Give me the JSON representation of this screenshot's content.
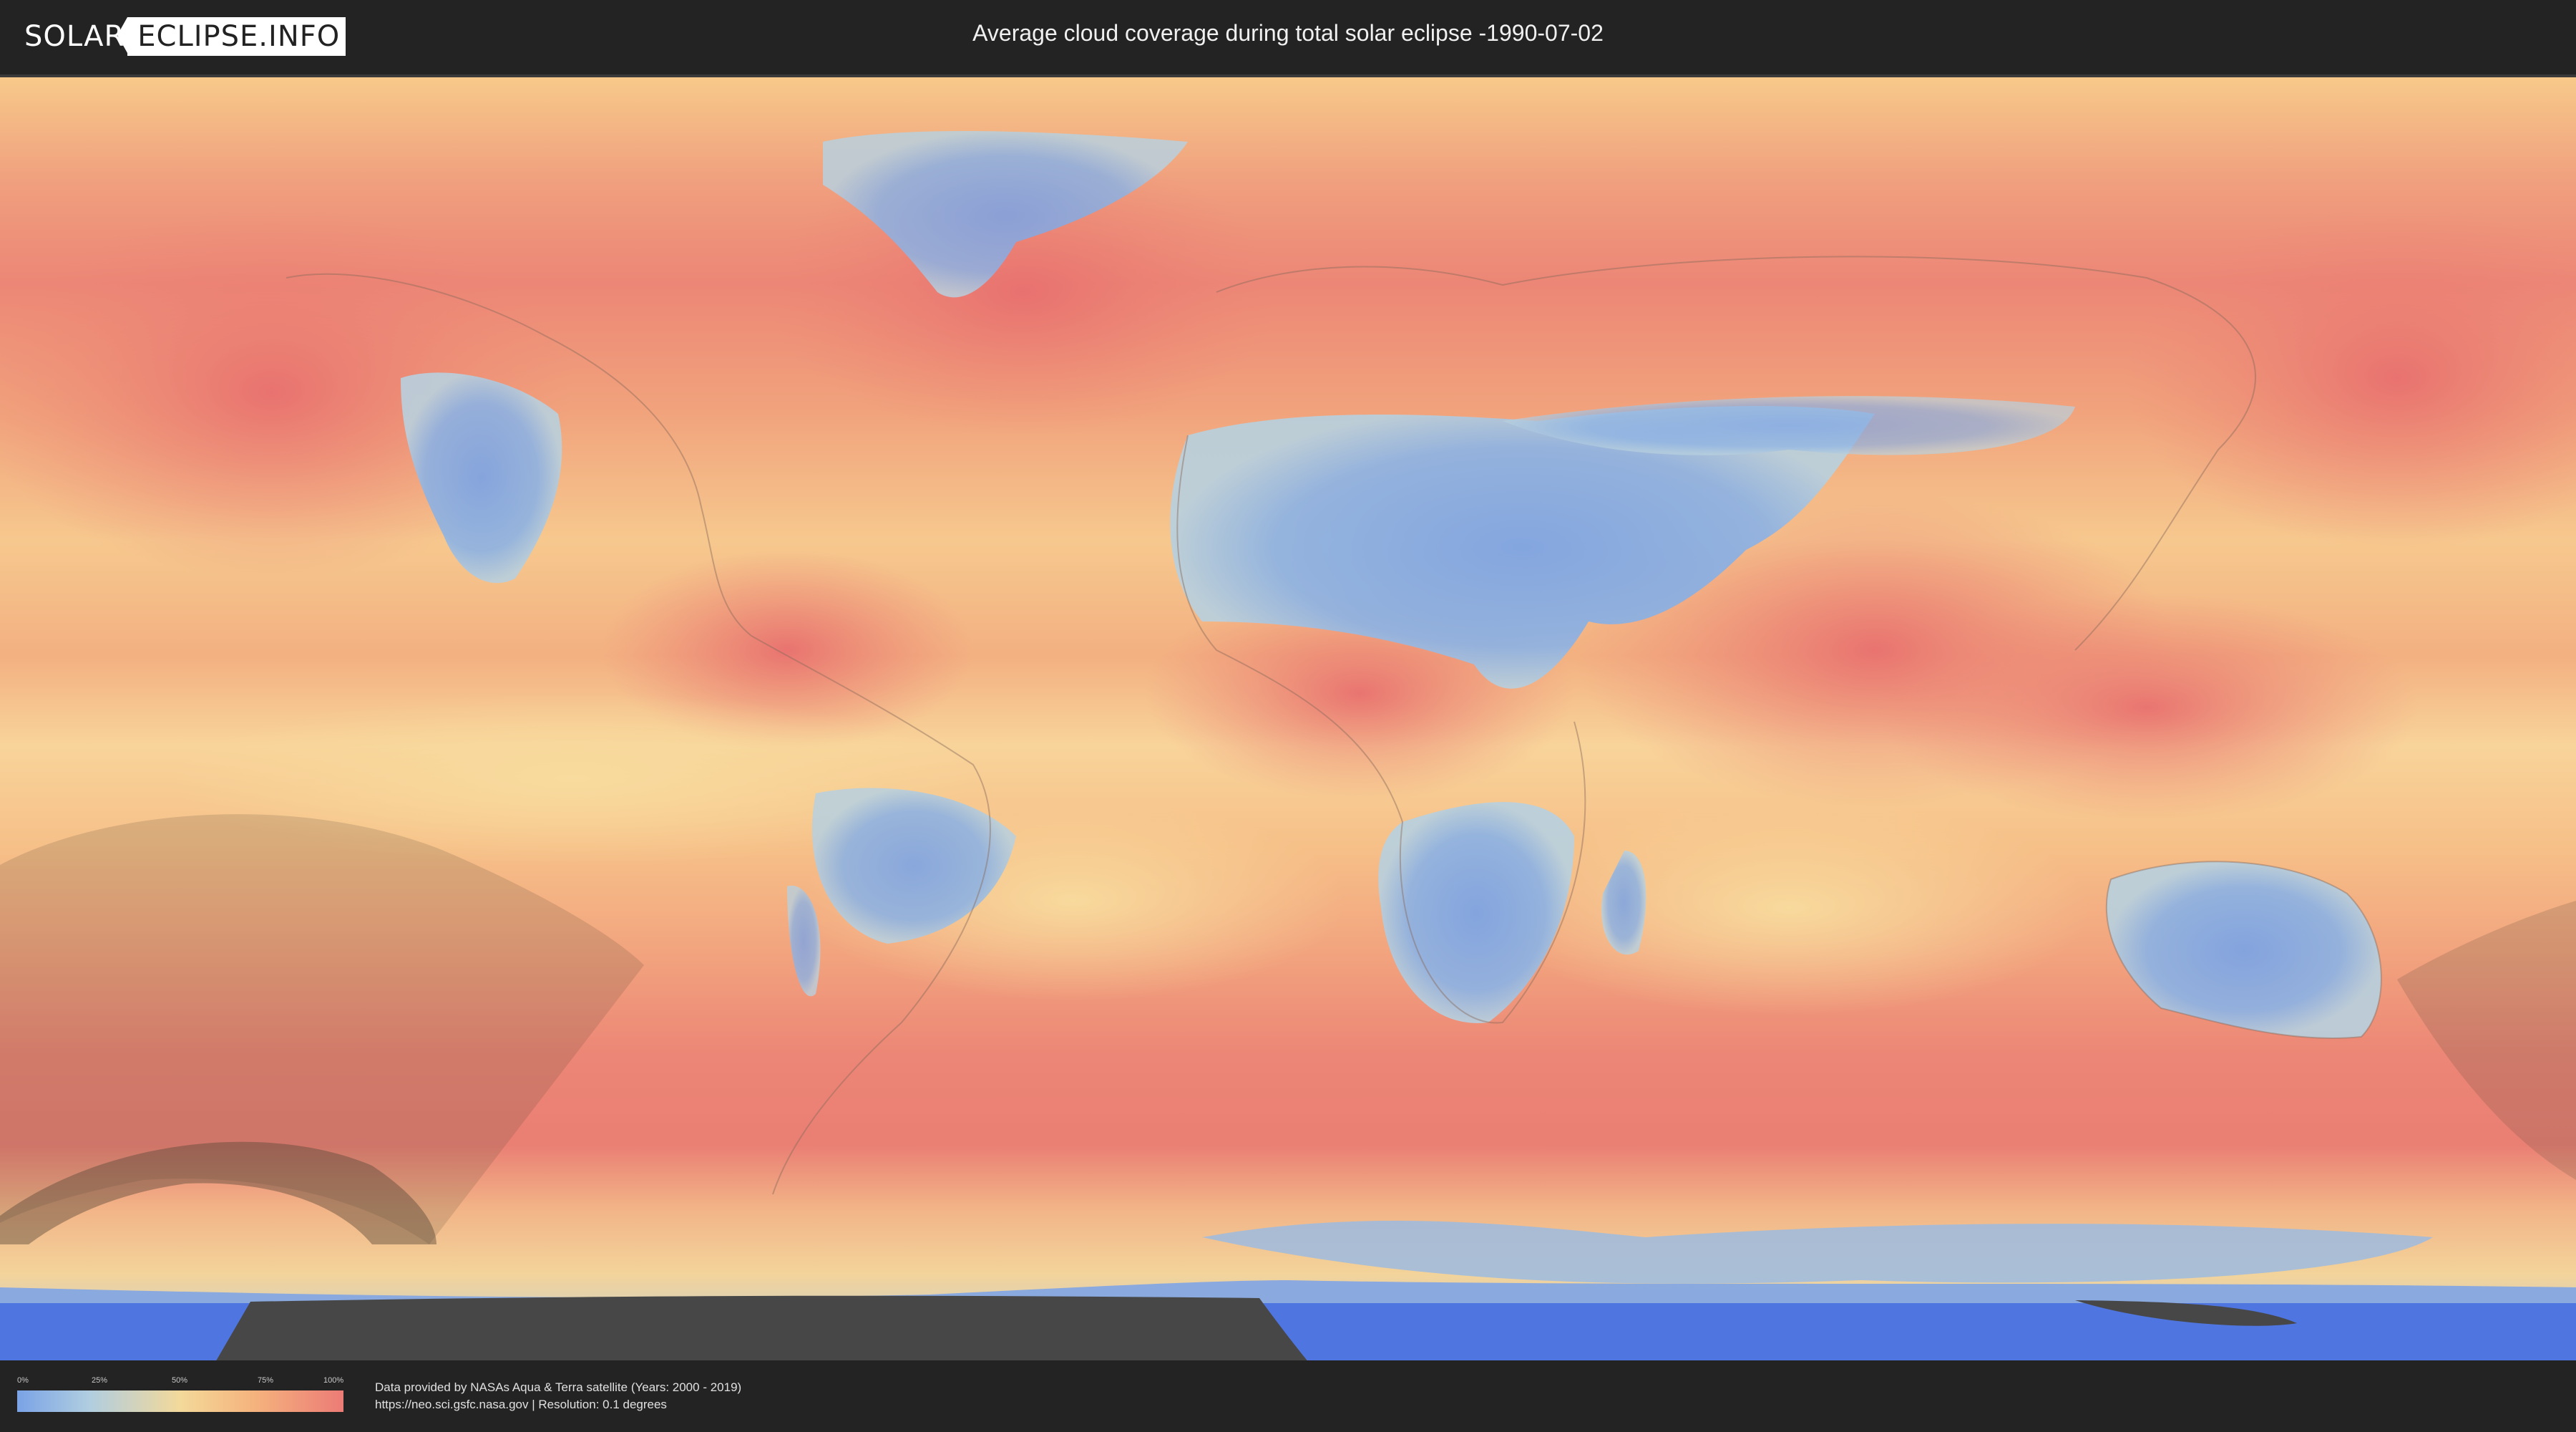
{
  "header": {
    "logo_left": "SOLAR",
    "logo_right": "ECLIPSE.INFO",
    "title": "Average cloud coverage during total solar eclipse -1990-07-02"
  },
  "map": {
    "projection": "equirectangular",
    "legend_colors": {
      "clear": "#7aa3e6",
      "low": "#b0cde0",
      "mid": "#f3d99a",
      "high": "#f5b47e",
      "overcast": "#ec7b76"
    },
    "eclipse_overlay_color": "#5a4a3a",
    "antarctica_color": "#4f76e0"
  },
  "legend": {
    "ticks": [
      "0%",
      "25%",
      "50%",
      "75%",
      "100%"
    ]
  },
  "footer": {
    "credit_line1": "Data provided by NASAs Aqua & Terra satellite (Years: 2000 - 2019)",
    "credit_line2": "https://neo.sci.gsfc.nasa.gov | Resolution: 0.1 degrees"
  }
}
